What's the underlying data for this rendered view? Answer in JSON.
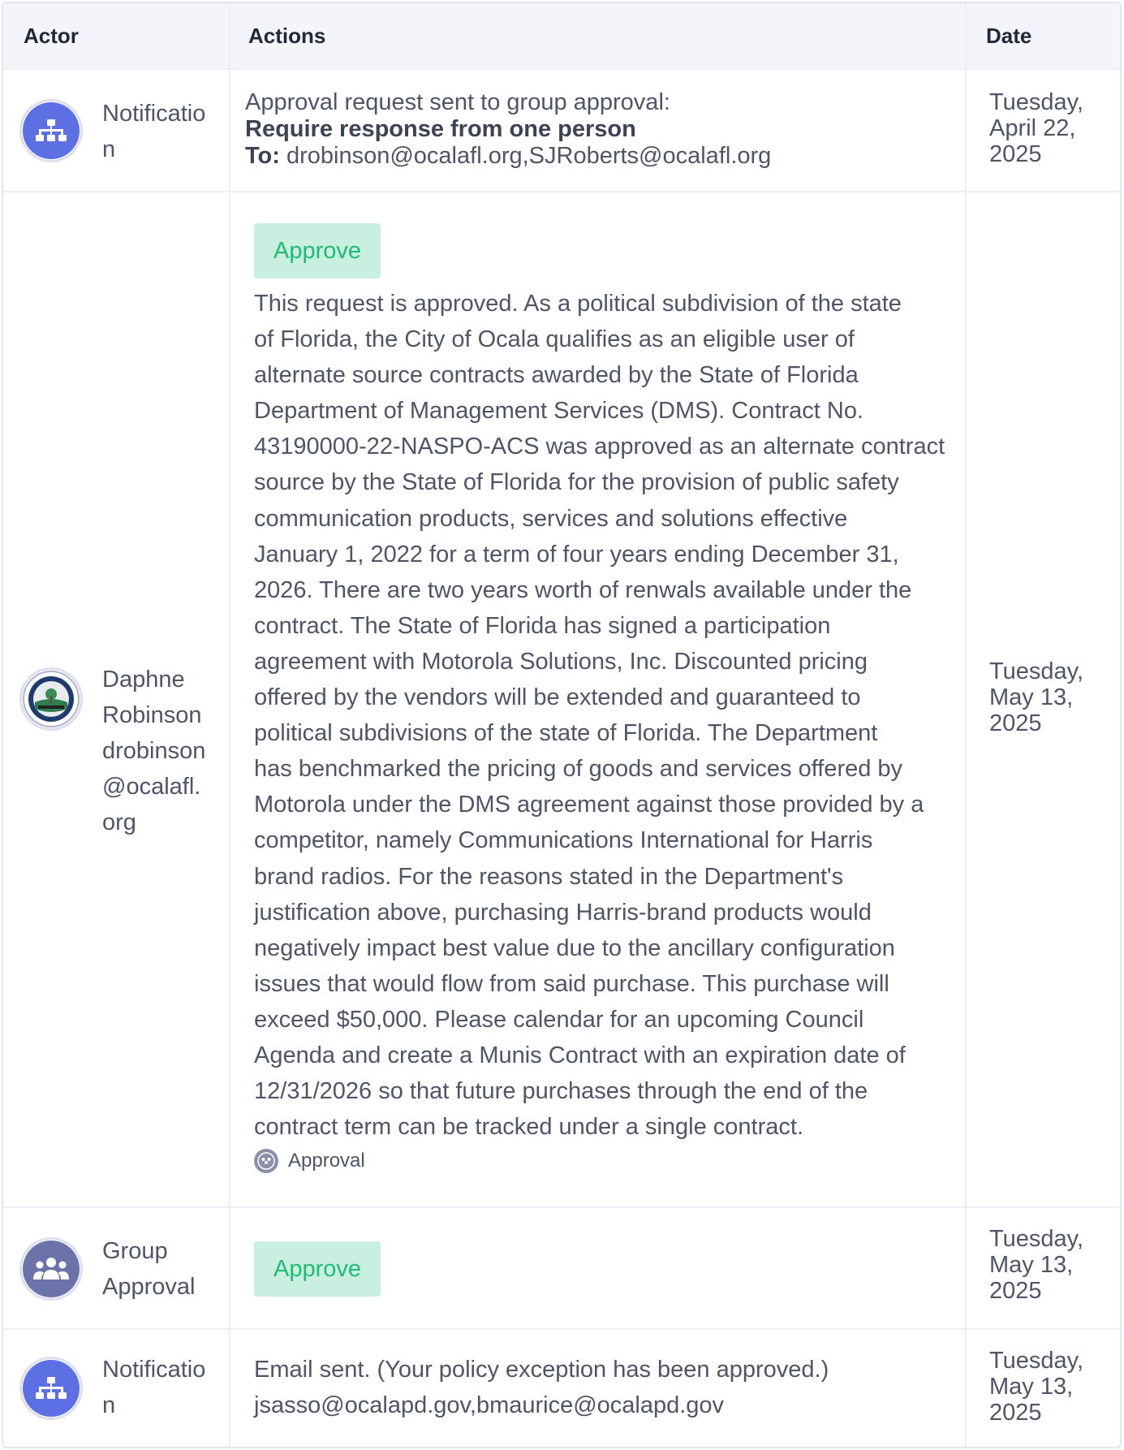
{
  "header": {
    "actor": "Actor",
    "actions": "Actions",
    "date": "Date"
  },
  "rows": [
    {
      "actor_icon": "sitemap-icon",
      "actor_lines": [
        "Notificatio",
        "n"
      ],
      "action": {
        "line1": "Approval request sent to group approval:",
        "line2": "Require response from one person",
        "to_label": "To:",
        "to_value": " drobinson@ocalafl.org,SJRoberts@ocalafl.org"
      },
      "date_lines": [
        "Tuesday,",
        "April 22,",
        "2025"
      ]
    },
    {
      "actor_icon": "city-seal-avatar",
      "actor_lines": [
        "Daphne",
        "Robinson",
        "drobinson",
        "@ocalafl.",
        "org"
      ],
      "action": {
        "button": "Approve",
        "comment_lines": [
          "This request is approved.  As a political subdivision of the state",
          "of Florida, the City of Ocala qualifies as an eligible user of",
          "alternate source contracts awarded by the State of Florida",
          "Department of Management Services (DMS).  Contract No.",
          "43190000-22-NASPO-ACS was approved as an alternate contract",
          "source by the State of Florida for the provision of public safety",
          "communication products, services and solutions effective",
          "January 1, 2022 for a term of four years ending December 31,",
          "2026.  There are two years worth of renwals available under the",
          "contract.  The State of Florida has signed a participation",
          "agreement with Motorola Solutions, Inc.  Discounted pricing",
          "offered by the vendors will be extended and guaranteed to",
          "political subdivisions of the state of Florida.   The Department",
          "has benchmarked the pricing of goods and services offered by",
          "Motorola under the DMS agreement against those provided by a",
          "competitor, namely Communications International for Harris",
          "brand radios.  For the reasons stated in the Department's",
          "justification above, purchasing Harris-brand products would",
          "negatively impact best value due to the ancillary configuration",
          "issues that would flow from said purchase.  This purchase will",
          "exceed $50,000.  Please calendar for an upcoming Council",
          "Agenda and create a Munis Contract with an expiration date of",
          "12/31/2026 so that future purchases through the end of the",
          "contract term can be tracked under a single contract."
        ],
        "tag": "Approval"
      },
      "date_lines": [
        "Tuesday,",
        "May 13,",
        "2025"
      ]
    },
    {
      "actor_icon": "group-icon",
      "actor_lines": [
        "Group",
        "Approval"
      ],
      "action": {
        "button": "Approve"
      },
      "date_lines": [
        "Tuesday,",
        "May 13,",
        "2025"
      ]
    },
    {
      "actor_icon": "sitemap-icon",
      "actor_lines": [
        "Notificatio",
        "n"
      ],
      "action": {
        "email_line1": "Email sent. (Your policy exception has been approved.)",
        "email_line2": "jsasso@ocalapd.gov,bmaurice@ocalapd.gov"
      },
      "date_lines": [
        "Tuesday,",
        "May 13,",
        "2025"
      ]
    }
  ],
  "colors": {
    "approve_bg": "#c8efdf",
    "approve_text": "#1fbc74",
    "notification_avatar": "#5c6fe3",
    "group_avatar": "#6b73a8"
  }
}
